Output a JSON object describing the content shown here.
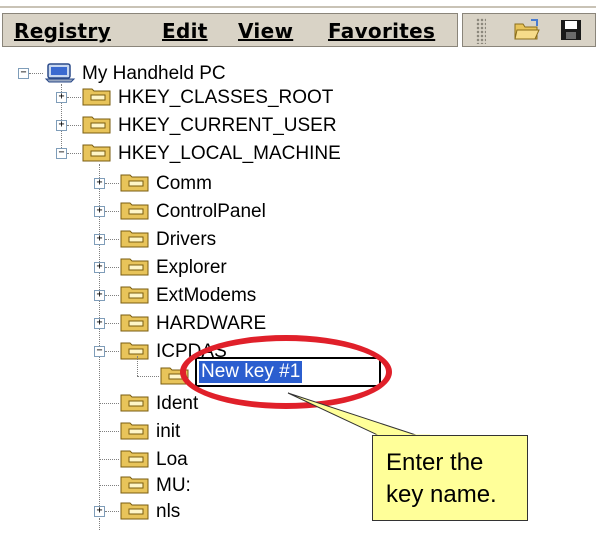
{
  "menu": {
    "items": [
      {
        "label": "Registry"
      },
      {
        "label": "Edit"
      },
      {
        "label": "View"
      },
      {
        "label": "Favorites"
      }
    ]
  },
  "toolbar": {
    "buttons": [
      {
        "icon": "open-folder-icon"
      },
      {
        "icon": "save-icon"
      }
    ]
  },
  "tree": {
    "root": "My Handheld PC",
    "hives": [
      "HKEY_CLASSES_ROOT",
      "HKEY_CURRENT_USER",
      "HKEY_LOCAL_MACHINE"
    ],
    "hklm_children": [
      "Comm",
      "ControlPanel",
      "Drivers",
      "Explorer",
      "ExtModems",
      "HARDWARE",
      "ICPDAS",
      "Ident",
      "init",
      "Loa",
      "MU:",
      "nls"
    ],
    "new_key_value": "New key #1"
  },
  "callout": {
    "line1": "Enter the",
    "line2": "key name."
  },
  "colors": {
    "highlight": "#e0202a",
    "selection": "#2b5ecf",
    "callout_bg": "#ffff99"
  }
}
